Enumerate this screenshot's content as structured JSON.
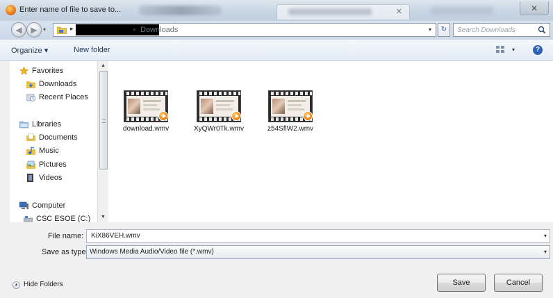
{
  "window": {
    "title": "Enter name of file to save to...",
    "close_glyph": "✕",
    "icon": "firefox-icon"
  },
  "address": {
    "breadcrumb_current": "Downloads",
    "breadcrumb_separator": "▸",
    "search_placeholder": "Search Downloads",
    "refresh_glyph": "↻",
    "dropdown_glyph": "▾"
  },
  "toolbar": {
    "organize_label": "Organize ▾",
    "new_folder_label": "New folder",
    "view_dropdown_glyph": "▾",
    "help_glyph": "?"
  },
  "sidebar": {
    "items": [
      {
        "label": "Favorites",
        "icon": "star-icon"
      },
      {
        "label": "Downloads",
        "icon": "downloads-folder-icon"
      },
      {
        "label": "Recent Places",
        "icon": "recent-places-icon"
      },
      {
        "label": "Libraries",
        "icon": "libraries-icon"
      },
      {
        "label": "Documents",
        "icon": "documents-icon"
      },
      {
        "label": "Music",
        "icon": "music-icon"
      },
      {
        "label": "Pictures",
        "icon": "pictures-icon"
      },
      {
        "label": "Videos",
        "icon": "videos-icon"
      },
      {
        "label": "Computer",
        "icon": "computer-icon"
      },
      {
        "label": "CSC ESOE (C:)",
        "icon": "drive-icon"
      }
    ],
    "scroll_up_glyph": "▲",
    "scroll_down_glyph": "▼"
  },
  "files": [
    {
      "name": "download.wmv"
    },
    {
      "name": "XyQWr0Tk.wmv"
    },
    {
      "name": "z54SflW2.wmv"
    }
  ],
  "form": {
    "file_name_label": "File name:",
    "file_name_value": "KiX86VEH.wmv",
    "save_as_type_label": "Save as type:",
    "save_as_type_value": "Windows Media Audio/Video file (*.wmv)",
    "dropdown_glyph": "▾"
  },
  "footer": {
    "hide_folders_label": "Hide Folders",
    "hide_folders_glyph": "▲",
    "save_label": "Save",
    "cancel_label": "Cancel"
  },
  "colors": {
    "accent": "#2e62b4",
    "toolbar_text": "#1e395b",
    "title_bar": "#c9d6e4"
  }
}
